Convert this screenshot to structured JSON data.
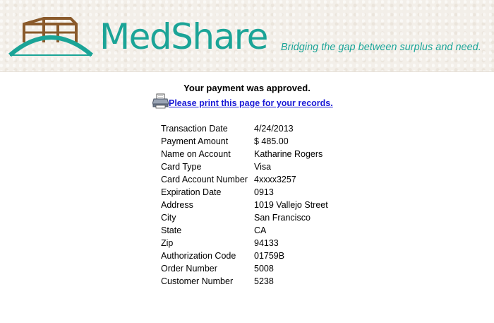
{
  "header": {
    "logo_text": "MedShare",
    "tagline": "Bridging the gap between surplus and need.",
    "brand_color": "#1ba497",
    "logo_icon": "house-bridge-logo-icon"
  },
  "main": {
    "approved_message": "Your payment was approved.",
    "print_link": "Please print this page for your records.",
    "print_icon": "printer-icon",
    "details": [
      {
        "label": "Transaction Date",
        "value": "4/24/2013"
      },
      {
        "label": "Payment Amount",
        "value": "$ 485.00"
      },
      {
        "label": "Name on Account",
        "value": "Katharine Rogers"
      },
      {
        "label": "Card Type",
        "value": "Visa"
      },
      {
        "label": "Card Account Number",
        "value": "4xxxx3257"
      },
      {
        "label": "Expiration Date",
        "value": "0913"
      },
      {
        "label": "Address",
        "value": "1019 Vallejo Street"
      },
      {
        "label": "City",
        "value": "San Francisco"
      },
      {
        "label": "State",
        "value": "CA"
      },
      {
        "label": "Zip",
        "value": "94133"
      },
      {
        "label": "Authorization Code",
        "value": "01759B"
      },
      {
        "label": "Order Number",
        "value": "5008"
      },
      {
        "label": "Customer Number",
        "value": "5238"
      }
    ]
  }
}
